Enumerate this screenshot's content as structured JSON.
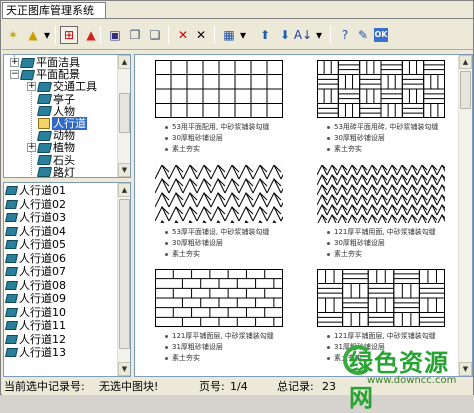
{
  "window": {
    "title": "天正图库管理系统"
  },
  "toolbar": {
    "buttons": [
      {
        "name": "new-icon",
        "glyph": "✶",
        "color": "#c8a000"
      },
      {
        "name": "open-icon",
        "glyph": "▲",
        "color": "#c8a000"
      },
      {
        "name": "dropdown-icon",
        "glyph": "▾",
        "color": "#000"
      },
      {
        "name": "grid-select-icon",
        "glyph": "⊞",
        "color": "#c00"
      },
      {
        "name": "warning-icon",
        "glyph": "▲",
        "color": "#d02020"
      },
      {
        "name": "save-icon",
        "glyph": "▣",
        "color": "#303080"
      },
      {
        "name": "layers-icon",
        "glyph": "❐",
        "color": "#405070"
      },
      {
        "name": "copy-icon",
        "glyph": "❏",
        "color": "#405070"
      },
      {
        "name": "delete-red-icon",
        "glyph": "✕",
        "color": "#d00000"
      },
      {
        "name": "delete-black-icon",
        "glyph": "✕",
        "color": "#000"
      },
      {
        "name": "view-grid-icon",
        "glyph": "▦",
        "color": "#2050a0"
      },
      {
        "name": "view-dropdown-icon",
        "glyph": "▾",
        "color": "#000"
      },
      {
        "name": "arrow-up-icon",
        "glyph": "⬆",
        "color": "#2060b0"
      },
      {
        "name": "arrow-down-icon",
        "glyph": "⬇",
        "color": "#2060b0"
      },
      {
        "name": "sort-icon",
        "glyph": "A↓",
        "color": "#2040a0"
      },
      {
        "name": "sort-dropdown-icon",
        "glyph": "▾",
        "color": "#000"
      },
      {
        "name": "help-icon",
        "glyph": "?",
        "color": "#2050b0"
      },
      {
        "name": "edit-icon",
        "glyph": "✎",
        "color": "#2050b0"
      },
      {
        "name": "ok-icon",
        "glyph": "OK",
        "color": "#fff"
      }
    ]
  },
  "tree": {
    "items": [
      {
        "label": "平面洁具",
        "level": 1,
        "expander": "+",
        "icon": "book"
      },
      {
        "label": "平面配景",
        "level": 1,
        "expander": "−",
        "icon": "book"
      },
      {
        "label": "交通工具",
        "level": 2,
        "expander": "+",
        "icon": "book"
      },
      {
        "label": "亭子",
        "level": 2,
        "expander": "",
        "icon": "book"
      },
      {
        "label": "人物",
        "level": 2,
        "expander": "",
        "icon": "book"
      },
      {
        "label": "人行道",
        "level": 2,
        "expander": "",
        "icon": "open",
        "selected": true
      },
      {
        "label": "动物",
        "level": 2,
        "expander": "",
        "icon": "book"
      },
      {
        "label": "植物",
        "level": 2,
        "expander": "+",
        "icon": "book"
      },
      {
        "label": "石头",
        "level": 2,
        "expander": "",
        "icon": "book"
      },
      {
        "label": "路灯",
        "level": 2,
        "expander": "",
        "icon": "book"
      }
    ]
  },
  "list": {
    "items": [
      "人行道01",
      "人行道02",
      "人行道03",
      "人行道04",
      "人行道05",
      "人行道06",
      "人行道07",
      "人行道08",
      "人行道09",
      "人行道10",
      "人行道11",
      "人行道12",
      "人行道13"
    ]
  },
  "gallery": {
    "cells": [
      {
        "pattern": "stack-bond",
        "lines": [
          "53用平面配用, 中砂浆铺装勾缝",
          "30厚粗砂铺设层",
          "素土夯实"
        ]
      },
      {
        "pattern": "basketweave",
        "lines": [
          "53用砖平面用砖, 中砂浆铺装勾缝",
          "30厚粗砂铺设层",
          "素土夯实"
        ]
      },
      {
        "pattern": "herringbone",
        "lines": [
          "53厚平面铺设, 中砂浆铺装勾缝",
          "30厚粗砂铺设层",
          "素土夯实"
        ]
      },
      {
        "pattern": "herringbone-dense",
        "lines": [
          "121厚平铺用面, 中砂浆铺装勾缝",
          "30厚粗砂铺设层",
          "素土夯实"
        ]
      },
      {
        "pattern": "running-bond",
        "lines": [
          "121厚平铺面层, 中砂浆铺装勾缝",
          "31厚粗砂铺设层",
          "素土夯实"
        ]
      },
      {
        "pattern": "basket-small",
        "lines": [
          "121厚平铺面层, 中砂浆铺装勾缝",
          "31厚粗砂铺设层",
          "素土夯实"
        ]
      }
    ]
  },
  "status": {
    "current_label": "当前选中记录号:",
    "current_value": "无选中图块!",
    "page_label": "页号:",
    "page_value": "1/4",
    "total_label": "总记录:",
    "total_value": "23"
  },
  "watermark": {
    "logo": "绿色资源网",
    "url": "www.downcc.com"
  }
}
